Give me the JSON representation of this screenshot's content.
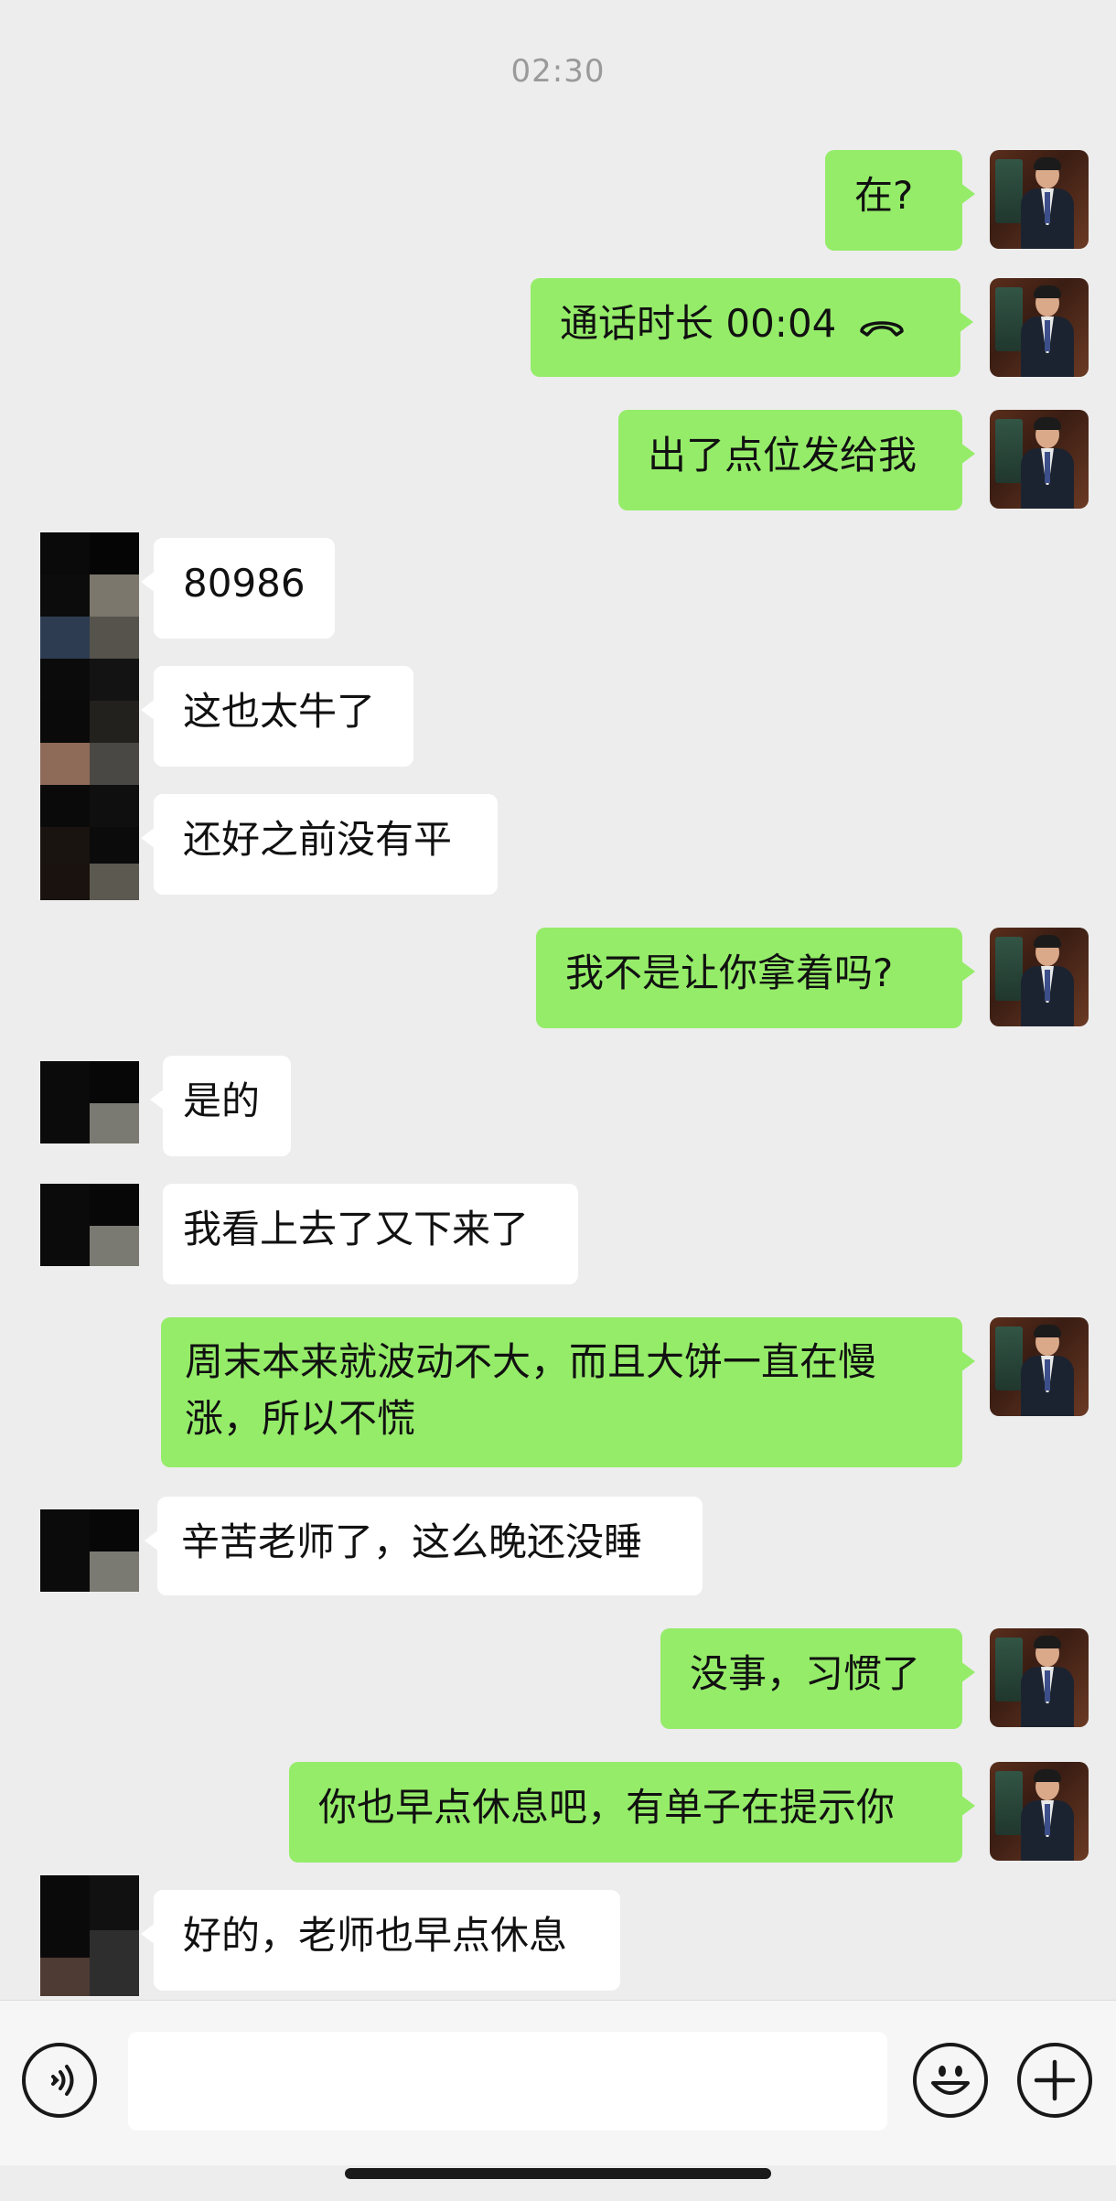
{
  "status": {
    "time": "02:30"
  },
  "messages": [
    {
      "side": "mine",
      "text": "在?"
    },
    {
      "side": "mine",
      "text": "通话时长  00:04",
      "icon": "phone-hangup-icon"
    },
    {
      "side": "mine",
      "text": "出了点位发给我"
    },
    {
      "side": "other",
      "text": "80986"
    },
    {
      "side": "other",
      "text": "这也太牛了"
    },
    {
      "side": "other",
      "text": "还好之前没有平"
    },
    {
      "side": "mine",
      "text": "我不是让你拿着吗?"
    },
    {
      "side": "other",
      "text": "是的"
    },
    {
      "side": "other",
      "text": "我看上去了又下来了"
    },
    {
      "side": "mine",
      "text": "周末本来就波动不大，而且大饼一直在慢涨，所以不慌"
    },
    {
      "side": "other",
      "text": "辛苦老师了，这么晚还没睡"
    },
    {
      "side": "mine",
      "text": "没事，习惯了"
    },
    {
      "side": "mine",
      "text": "你也早点休息吧，有单子在提示你"
    },
    {
      "side": "other",
      "text": "好的，老师也早点休息"
    }
  ],
  "input": {
    "value": "",
    "placeholder": ""
  },
  "colors": {
    "mine_bubble": "#95ec69",
    "other_bubble": "#ffffff",
    "background": "#ededed"
  },
  "icons": {
    "voice": "voice-icon",
    "emoji": "emoji-icon",
    "plus": "plus-icon"
  }
}
